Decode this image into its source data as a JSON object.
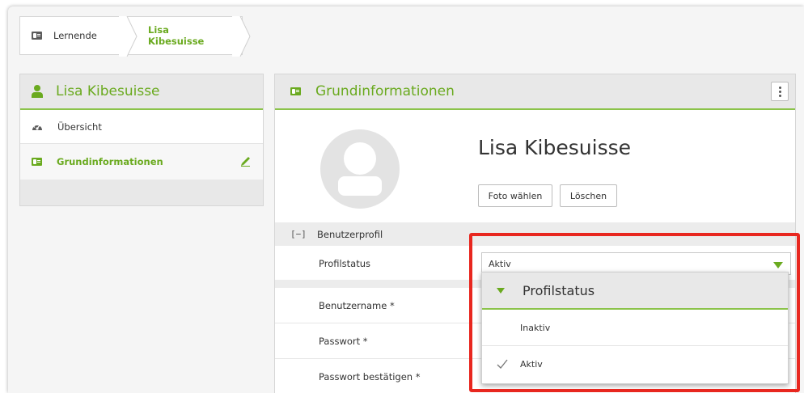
{
  "breadcrumb": {
    "items": [
      {
        "label": "Lernende",
        "icon": "contact-card-icon"
      },
      {
        "label": "Lisa Kibesuisse"
      }
    ]
  },
  "sidebar": {
    "title": "Lisa Kibesuisse",
    "title_icon": "person-icon",
    "items": [
      {
        "label": "Übersicht",
        "icon": "dashboard-gauge-icon",
        "active": false
      },
      {
        "label": "Grundinformationen",
        "icon": "contact-card-icon",
        "active": true,
        "trailing_icon": "pencil-icon"
      }
    ]
  },
  "main": {
    "title": "Grundinformationen",
    "title_icon": "contact-card-icon",
    "menu_icon": "vertical-dots-icon",
    "profile": {
      "name": "Lisa Kibesuisse",
      "avatar_icon": "avatar-placeholder-icon",
      "buttons": {
        "choose_photo": "Foto wählen",
        "delete": "Löschen"
      }
    },
    "section": {
      "title": "Benutzerprofil",
      "collapse_symbol": "[−]"
    },
    "fields": {
      "profile_status": {
        "label": "Profilstatus",
        "value": "Aktiv"
      },
      "username": {
        "label": "Benutzername *"
      },
      "password": {
        "label": "Passwort *"
      },
      "password_confirm": {
        "label": "Passwort bestätigen *"
      }
    }
  },
  "dropdown": {
    "title": "Profilstatus",
    "options": [
      {
        "label": "Inaktiv",
        "selected": false
      },
      {
        "label": "Aktiv",
        "selected": true
      }
    ]
  },
  "colors": {
    "accent": "#6aaa1f",
    "accent_line": "#8bc34a",
    "highlight": "#e8271f",
    "panel_header": "#e8e8e8"
  }
}
